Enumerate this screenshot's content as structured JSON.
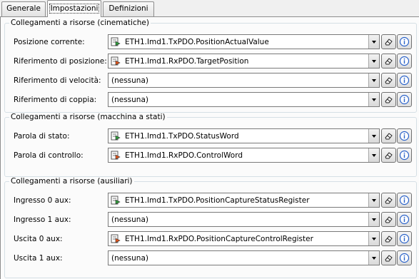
{
  "tabs": [
    {
      "label": "Generale",
      "active": false
    },
    {
      "label": "Impostazioni",
      "active": true
    },
    {
      "label": "Definizioni",
      "active": false
    }
  ],
  "groups": [
    {
      "title": "Collegamenti a risorse (cinematiche)",
      "rows": [
        {
          "label": "Posizione corrente:",
          "value": "ETH1.Imd1.TxPDO.PositionActualValue",
          "icon": "tx-pdo-icon"
        },
        {
          "label": "Riferimento di posizione:",
          "value": "ETH1.Imd1.RxPDO.TargetPosition",
          "icon": "rx-pdo-icon"
        },
        {
          "label": "Riferimento di velocità:",
          "value": "(nessuna)",
          "icon": ""
        },
        {
          "label": "Riferimento di coppia:",
          "value": "(nessuna)",
          "icon": ""
        }
      ]
    },
    {
      "title": "Collegamenti a risorse (macchina a stati)",
      "rows": [
        {
          "label": "Parola di stato:",
          "value": "ETH1.Imd1.TxPDO.StatusWord",
          "icon": "tx-pdo-icon"
        },
        {
          "label": "Parola di controllo:",
          "value": "ETH1.Imd1.RxPDO.ControlWord",
          "icon": "rx-pdo-icon"
        }
      ]
    },
    {
      "title": "Collegamenti a risorse (ausiliari)",
      "rows": [
        {
          "label": "Ingresso 0 aux:",
          "value": "ETH1.Imd1.TxPDO.PositionCaptureStatusRegister",
          "icon": "tx-pdo-icon"
        },
        {
          "label": "Ingresso 1 aux:",
          "value": "(nessuna)",
          "icon": ""
        },
        {
          "label": "Uscita 0 aux:",
          "value": "ETH1.Imd1.RxPDO.PositionCaptureControlRegister",
          "icon": "rx-pdo-icon"
        },
        {
          "label": "Uscita 1 aux:",
          "value": "(nessuna)",
          "icon": ""
        }
      ]
    }
  ],
  "colors": {
    "tx_icon": "#2e9b3a",
    "rx_icon": "#e0541b",
    "info": "#2a62c9"
  }
}
